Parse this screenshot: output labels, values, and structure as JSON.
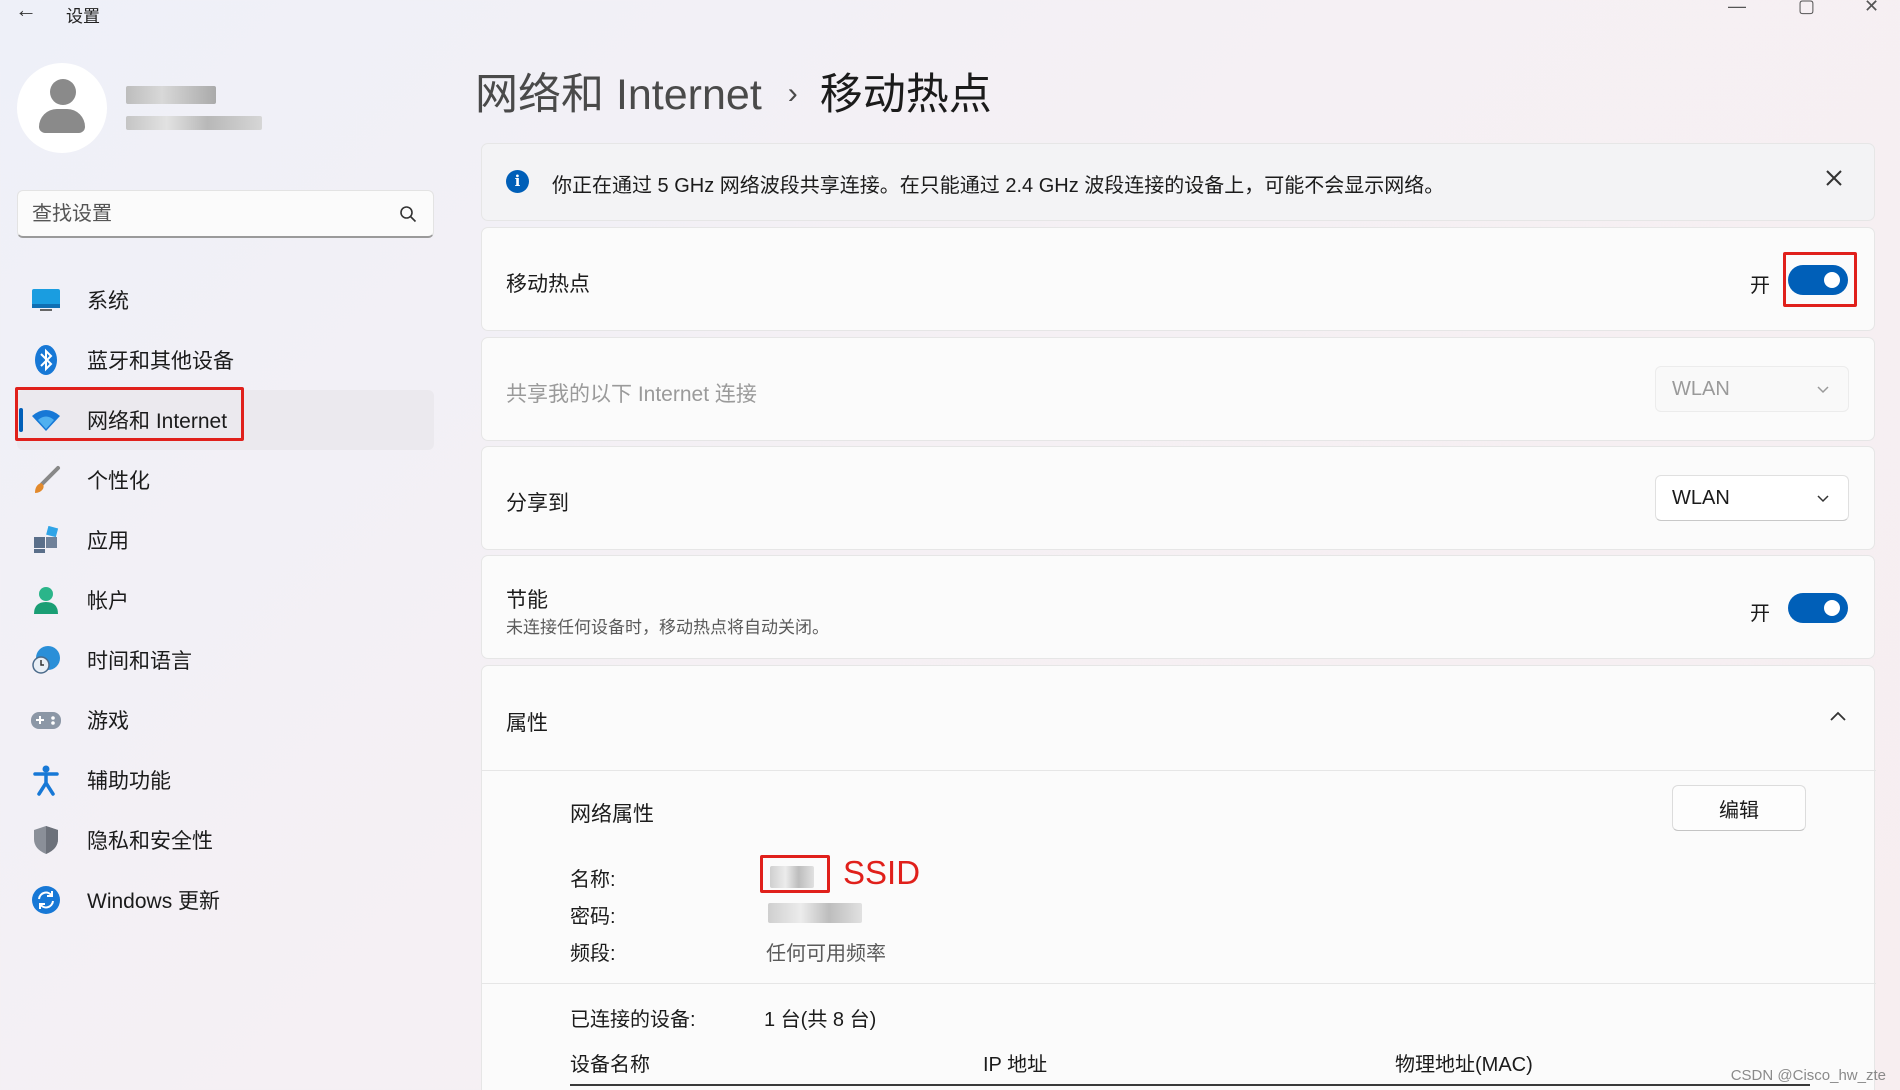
{
  "app": {
    "title": "设置"
  },
  "search": {
    "placeholder": "查找设置"
  },
  "nav": {
    "items": [
      {
        "label": "系统",
        "icon": "monitor-icon"
      },
      {
        "label": "蓝牙和其他设备",
        "icon": "bluetooth-icon"
      },
      {
        "label": "网络和 Internet",
        "icon": "wifi-icon",
        "active": true
      },
      {
        "label": "个性化",
        "icon": "paintbrush-icon"
      },
      {
        "label": "应用",
        "icon": "apps-icon"
      },
      {
        "label": "帐户",
        "icon": "account-icon"
      },
      {
        "label": "时间和语言",
        "icon": "globe-clock-icon"
      },
      {
        "label": "游戏",
        "icon": "gamepad-icon"
      },
      {
        "label": "辅助功能",
        "icon": "accessibility-icon"
      },
      {
        "label": "隐私和安全性",
        "icon": "shield-icon"
      },
      {
        "label": "Windows 更新",
        "icon": "update-icon"
      }
    ]
  },
  "breadcrumb": {
    "parent": "网络和 Internet",
    "separator": "›",
    "current": "移动热点"
  },
  "info_bar": {
    "text": "你正在通过 5 GHz 网络波段共享连接。在只能通过 2.4 GHz 波段连接的设备上，可能不会显示网络。"
  },
  "hotspot": {
    "label": "移动热点",
    "state": "开"
  },
  "share_from": {
    "label": "共享我的以下 Internet 连接",
    "value": "WLAN"
  },
  "share_to": {
    "label": "分享到",
    "value": "WLAN"
  },
  "power_saving": {
    "label": "节能",
    "description": "未连接任何设备时，移动热点将自动关闭。",
    "state": "开"
  },
  "properties": {
    "title": "属性",
    "network_properties": "网络属性",
    "edit_label": "编辑",
    "name_key": "名称:",
    "password_key": "密码:",
    "band_key": "频段:",
    "band_value": "任何可用频率",
    "ssid_annotation": "SSID",
    "connected_key": "已连接的设备:",
    "connected_value": "1 台(共 8 台)",
    "columns": [
      "设备名称",
      "IP 地址",
      "物理地址(MAC)"
    ]
  },
  "watermark": "CSDN @Cisco_hw_zte",
  "colors": {
    "accent": "#005fb8",
    "annotation_red": "#e0201b"
  }
}
